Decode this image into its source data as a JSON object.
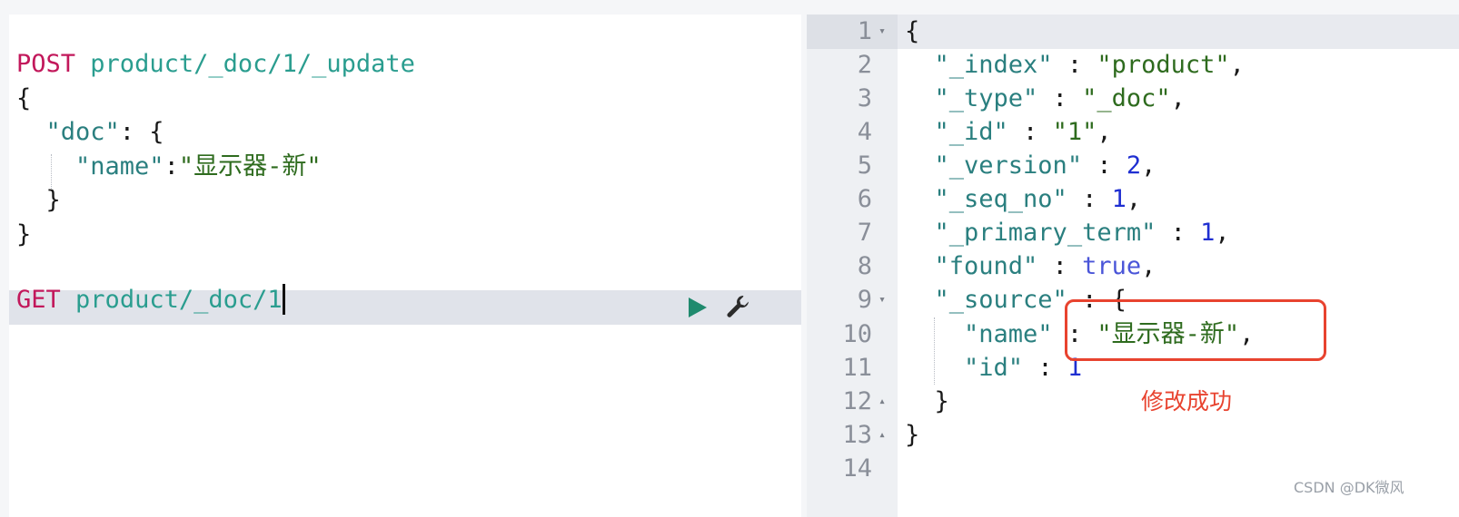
{
  "request_editor": {
    "request1": {
      "method": "POST",
      "path": "product/_doc/1/_update",
      "open_brace": "{",
      "doc_key": "\"doc\"",
      "doc_colon": ": {",
      "name_key": "\"name\"",
      "name_colon": ":",
      "name_value": "\"显示器-新\"",
      "inner_close": "}",
      "outer_close": "}"
    },
    "request2": {
      "method": "GET",
      "path": "product/_doc/1"
    }
  },
  "response_viewer": {
    "line_numbers": [
      "1",
      "2",
      "3",
      "4",
      "5",
      "6",
      "7",
      "8",
      "9",
      "10",
      "11",
      "12",
      "13",
      "14"
    ],
    "fold_markers": {
      "l1": "▾",
      "l9": "▾",
      "l12": "▴",
      "l13": "▴"
    },
    "lines": {
      "l1": "{",
      "index_key": "\"_index\"",
      "index_val": "\"product\"",
      "type_key": "\"_type\"",
      "type_val": "\"_doc\"",
      "id_key": "\"_id\"",
      "id_val": "\"1\"",
      "version_key": "\"_version\"",
      "version_val": "2",
      "seq_key": "\"_seq_no\"",
      "seq_val": "1",
      "term_key": "\"_primary_term\"",
      "term_val": "1",
      "found_key": "\"found\"",
      "found_val": "true",
      "source_key": "\"_source\"",
      "source_open": "{",
      "name_key": "\"name\"",
      "name_val": "\"显示器-新\"",
      "sid_key": "\"id\"",
      "sid_val": "1",
      "source_close": "}",
      "l13": "}"
    }
  },
  "annotation": {
    "text": "修改成功",
    "color": "#e8432f"
  },
  "watermark": "CSDN @DK微风",
  "icons": {
    "run": "play-icon",
    "settings": "wrench-icon"
  }
}
